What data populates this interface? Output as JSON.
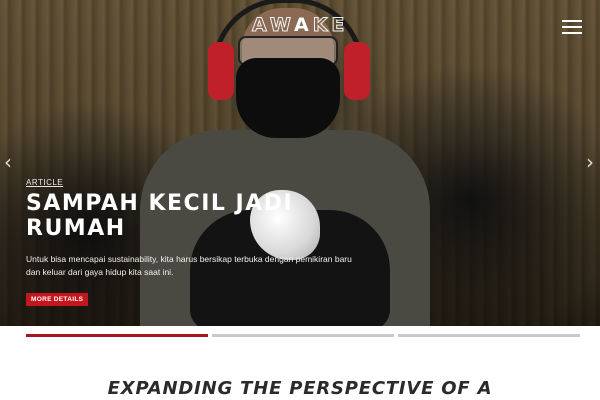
{
  "header": {
    "logo": {
      "before": "AW",
      "accent": "A",
      "after": "KE"
    },
    "menu_icon": "hamburger-menu-icon"
  },
  "hero": {
    "kicker": "ARTICLE",
    "headline": "SAMPAH KECIL JADI RUMAH",
    "description": "Untuk bisa mencapai sustainability, kita harus bersikap terbuka dengan pemikiran baru dan keluar dari gaya hidup kita saat ini.",
    "cta_label": "MORE DETAILS",
    "prev_icon": "chevron-left-icon",
    "next_icon": "chevron-right-icon",
    "prev_glyph": "‹",
    "next_glyph": "›"
  },
  "slider": {
    "slides": 3,
    "active_index": 0,
    "active_progress": 1.0
  },
  "colors": {
    "accent": "#c4161c",
    "progress": "#a8161b",
    "inactive_bar": "#c9c9c9"
  },
  "section": {
    "title": "EXPANDING THE PERSPECTIVE OF A"
  }
}
